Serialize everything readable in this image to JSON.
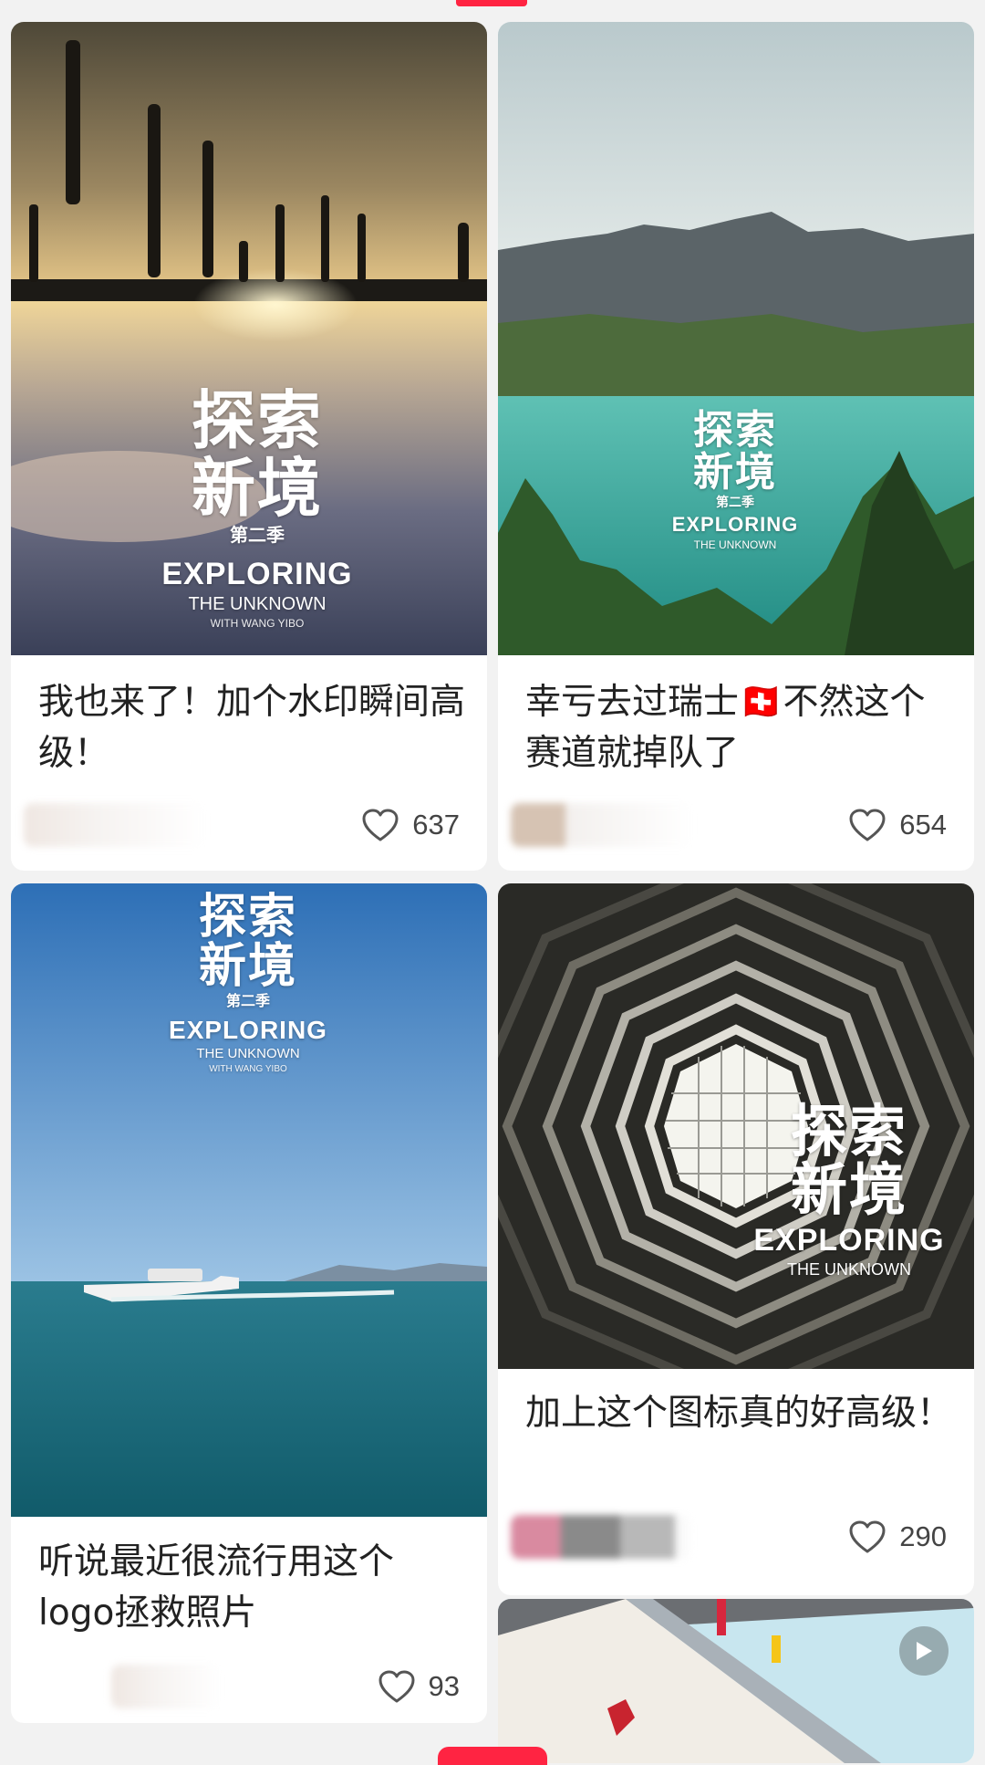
{
  "cards": [
    {
      "title": "我也来了！加个水印瞬间高级！",
      "likes": "637",
      "watermark": {
        "cn1": "探索",
        "cn2": "新境",
        "season": "第二季",
        "en1": "EXPLORING",
        "en2": "THE UNKNOWN",
        "en3": "WITH WANG YIBO"
      }
    },
    {
      "title": "幸亏去过瑞士🇨🇭不然这个赛道就掉队了",
      "likes": "654",
      "watermark": {
        "cn1": "探索",
        "cn2": "新境",
        "season": "第二季",
        "en1": "EXPLORING",
        "en2": "THE UNKNOWN"
      }
    },
    {
      "title": "听说最近很流行用这个logo拯救照片",
      "likes": "93",
      "watermark": {
        "cn1": "探索",
        "cn2": "新境",
        "season": "第二季",
        "en1": "EXPLORING",
        "en2": "THE UNKNOWN",
        "en3": "WITH WANG YIBO"
      }
    },
    {
      "title": "加上这个图标真的好高级！",
      "likes": "290",
      "watermark": {
        "cn1": "探索",
        "cn2": "新境",
        "en1": "EXPLORING",
        "en2": "THE UNKNOWN"
      }
    },
    {
      "type": "video",
      "icon": "play-icon"
    }
  ],
  "colors": {
    "accent": "#ff2442",
    "background": "#f2f2f2"
  }
}
